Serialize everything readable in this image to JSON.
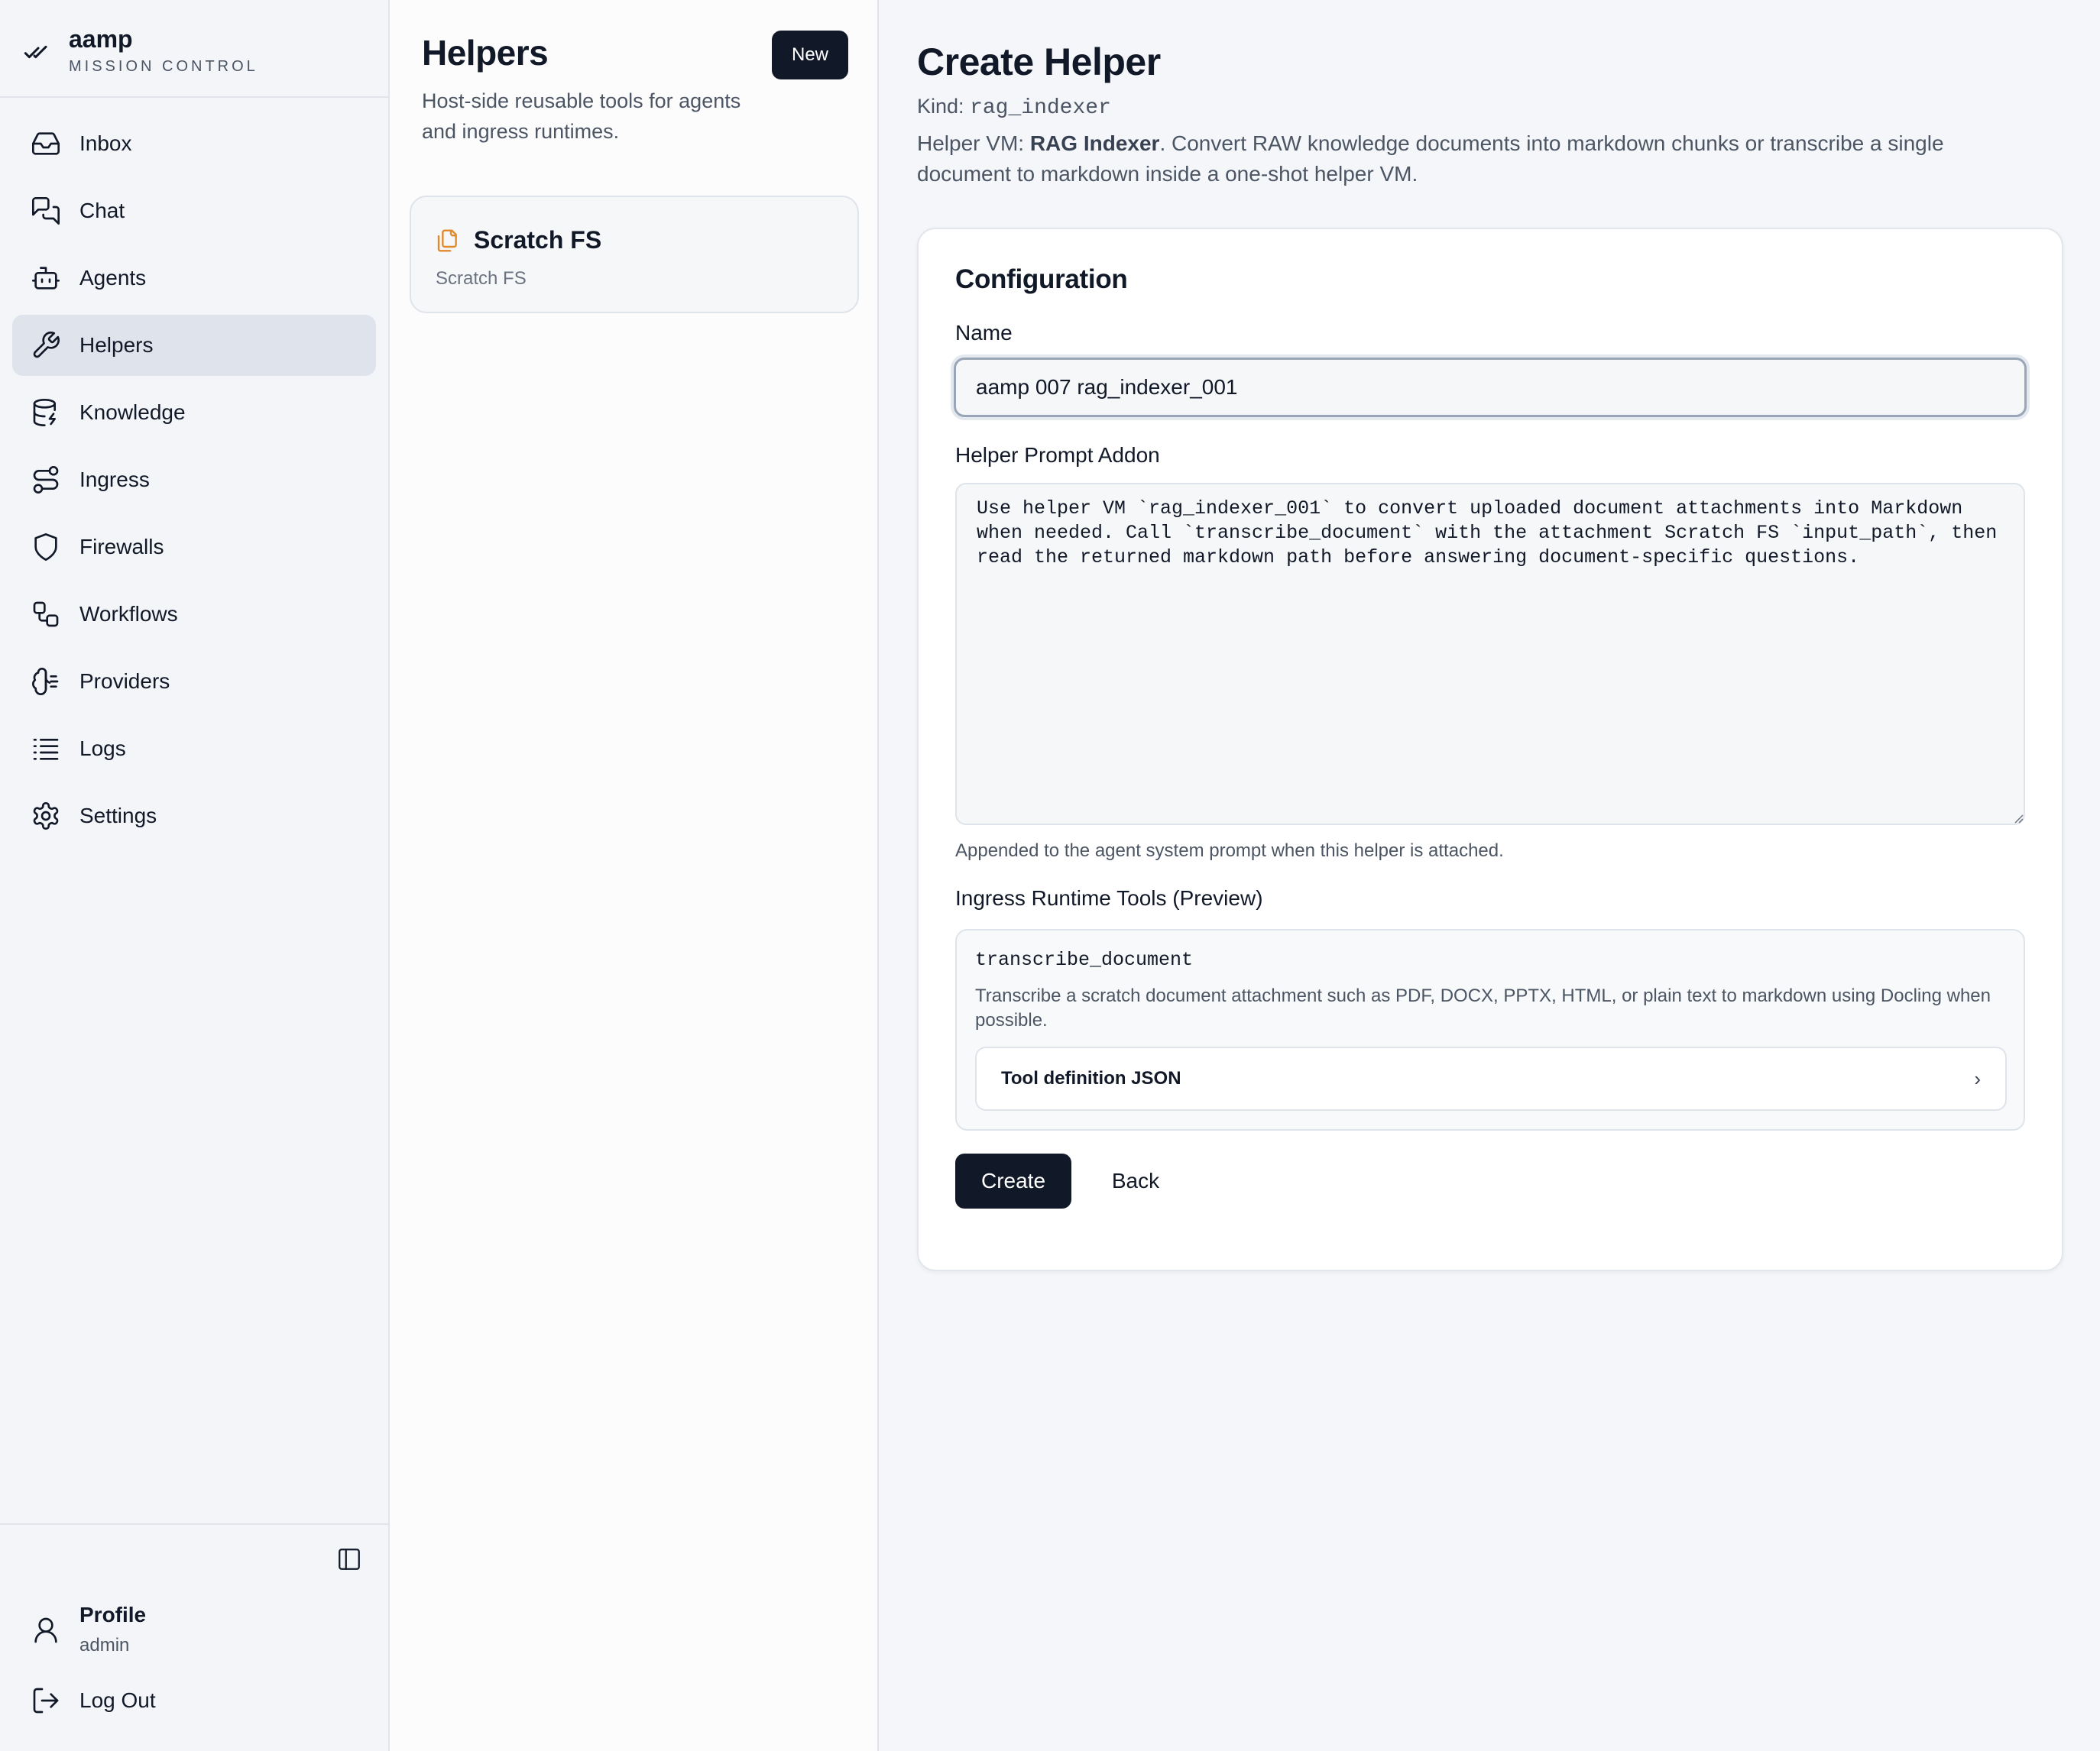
{
  "brand": {
    "name": "aamp",
    "subtitle": "MISSION CONTROL"
  },
  "sidebar": {
    "items": [
      {
        "label": "Inbox",
        "icon": "inbox-icon"
      },
      {
        "label": "Chat",
        "icon": "chat-icon"
      },
      {
        "label": "Agents",
        "icon": "bot-icon"
      },
      {
        "label": "Helpers",
        "icon": "wrench-icon",
        "active": true
      },
      {
        "label": "Knowledge",
        "icon": "database-icon"
      },
      {
        "label": "Ingress",
        "icon": "route-icon"
      },
      {
        "label": "Firewalls",
        "icon": "shield-icon"
      },
      {
        "label": "Workflows",
        "icon": "workflow-icon"
      },
      {
        "label": "Providers",
        "icon": "brain-icon"
      },
      {
        "label": "Logs",
        "icon": "list-icon"
      },
      {
        "label": "Settings",
        "icon": "gear-icon"
      }
    ],
    "profile": {
      "name": "Profile",
      "role": "admin"
    },
    "logout_label": "Log Out"
  },
  "helpers_panel": {
    "title": "Helpers",
    "new_label": "New",
    "description": "Host-side reusable tools for agents and ingress runtimes.",
    "items": [
      {
        "title": "Scratch FS",
        "subtitle": "Scratch FS"
      }
    ]
  },
  "main": {
    "title": "Create Helper",
    "kind_prefix": "Kind:",
    "kind_value": "rag_indexer",
    "vm_prefix": "Helper VM:",
    "vm_name": "RAG Indexer",
    "vm_description": ". Convert RAW knowledge documents into markdown chunks or transcribe a single document to markdown inside a one-shot helper VM.",
    "config": {
      "title": "Configuration",
      "name_label": "Name",
      "name_value": "aamp 007 rag_indexer_001",
      "prompt_label": "Helper Prompt Addon",
      "prompt_value": "Use helper VM `rag_indexer_001` to convert uploaded document attachments into Markdown when needed. Call `transcribe_document` with the attachment Scratch FS `input_path`, then read the returned markdown path before answering document-specific questions.",
      "prompt_help": "Appended to the agent system prompt when this helper is attached.",
      "tools_label": "Ingress Runtime Tools (Preview)",
      "tool_name": "transcribe_document",
      "tool_description": "Transcribe a scratch document attachment such as PDF, DOCX, PPTX, HTML, or plain text to markdown using Docling when possible.",
      "tool_definition_label": "Tool definition JSON",
      "create_label": "Create",
      "back_label": "Back"
    }
  },
  "colors": {
    "primary": "#111827",
    "active_nav": "#dfe4ec",
    "helper_icon": "#e08a2c"
  }
}
